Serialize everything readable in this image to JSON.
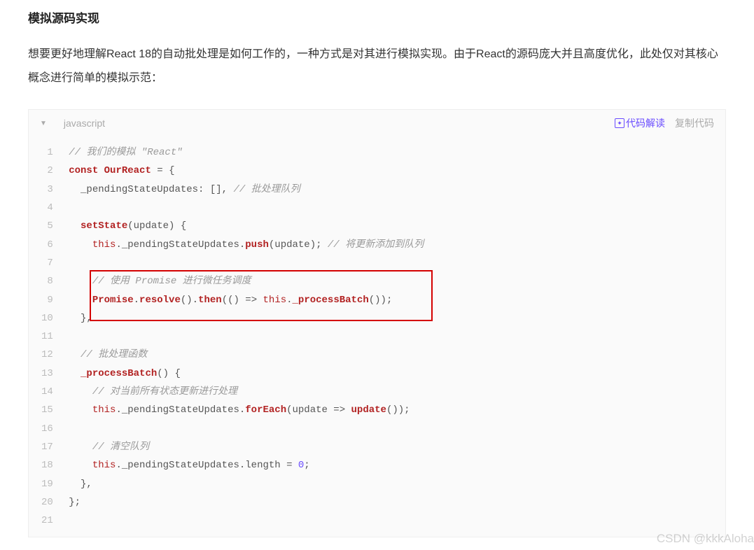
{
  "section_title": "模拟源码实现",
  "paragraph": "想要更好地理解React 18的自动批处理是如何工作的，一种方式是对其进行模拟实现。由于React的源码庞大并且高度优化，此处仅对其核心概念进行简单的模拟示范：",
  "code_header": {
    "language": "javascript",
    "explain_label": "代码解读",
    "copy_label": "复制代码"
  },
  "line_count": 21,
  "code_lines": [
    {
      "tokens": [
        {
          "t": " ",
          "c": ""
        },
        {
          "t": "// 我们的模拟 \"React\"",
          "c": "c-comment"
        }
      ]
    },
    {
      "tokens": [
        {
          "t": " ",
          "c": ""
        },
        {
          "t": "const",
          "c": "c-kw"
        },
        {
          "t": " ",
          "c": ""
        },
        {
          "t": "OurReact",
          "c": "c-fn"
        },
        {
          "t": " = {",
          "c": ""
        }
      ]
    },
    {
      "tokens": [
        {
          "t": "   _pendingStateUpdates: [], ",
          "c": ""
        },
        {
          "t": "// 批处理队列",
          "c": "c-comment"
        }
      ]
    },
    {
      "tokens": []
    },
    {
      "tokens": [
        {
          "t": "   ",
          "c": ""
        },
        {
          "t": "setState",
          "c": "c-fn"
        },
        {
          "t": "(update) {",
          "c": ""
        }
      ]
    },
    {
      "tokens": [
        {
          "t": "     ",
          "c": ""
        },
        {
          "t": "this",
          "c": "c-this"
        },
        {
          "t": "._pendingStateUpdates.",
          "c": ""
        },
        {
          "t": "push",
          "c": "c-fn"
        },
        {
          "t": "(update); ",
          "c": ""
        },
        {
          "t": "// 将更新添加到队列",
          "c": "c-comment"
        }
      ]
    },
    {
      "tokens": []
    },
    {
      "tokens": [
        {
          "t": "     ",
          "c": ""
        },
        {
          "t": "// 使用 Promise 进行微任务调度",
          "c": "c-comment"
        }
      ]
    },
    {
      "tokens": [
        {
          "t": "     ",
          "c": ""
        },
        {
          "t": "Promise",
          "c": "c-fn"
        },
        {
          "t": ".",
          "c": ""
        },
        {
          "t": "resolve",
          "c": "c-fn"
        },
        {
          "t": "().",
          "c": ""
        },
        {
          "t": "then",
          "c": "c-fn"
        },
        {
          "t": "(() => ",
          "c": ""
        },
        {
          "t": "this",
          "c": "c-this"
        },
        {
          "t": ".",
          "c": ""
        },
        {
          "t": "_processBatch",
          "c": "c-fn"
        },
        {
          "t": "());",
          "c": ""
        }
      ]
    },
    {
      "tokens": [
        {
          "t": "   },",
          "c": ""
        }
      ]
    },
    {
      "tokens": []
    },
    {
      "tokens": [
        {
          "t": "   ",
          "c": ""
        },
        {
          "t": "// 批处理函数",
          "c": "c-comment"
        }
      ]
    },
    {
      "tokens": [
        {
          "t": "   ",
          "c": ""
        },
        {
          "t": "_processBatch",
          "c": "c-fn"
        },
        {
          "t": "() {",
          "c": ""
        }
      ]
    },
    {
      "tokens": [
        {
          "t": "     ",
          "c": ""
        },
        {
          "t": "// 对当前所有状态更新进行处理",
          "c": "c-comment"
        }
      ]
    },
    {
      "tokens": [
        {
          "t": "     ",
          "c": ""
        },
        {
          "t": "this",
          "c": "c-this"
        },
        {
          "t": "._pendingStateUpdates.",
          "c": ""
        },
        {
          "t": "forEach",
          "c": "c-fn"
        },
        {
          "t": "(update => ",
          "c": ""
        },
        {
          "t": "update",
          "c": "c-fn"
        },
        {
          "t": "());",
          "c": ""
        }
      ]
    },
    {
      "tokens": []
    },
    {
      "tokens": [
        {
          "t": "     ",
          "c": ""
        },
        {
          "t": "// 清空队列",
          "c": "c-comment"
        }
      ]
    },
    {
      "tokens": [
        {
          "t": "     ",
          "c": ""
        },
        {
          "t": "this",
          "c": "c-this"
        },
        {
          "t": "._pendingStateUpdates.length = ",
          "c": ""
        },
        {
          "t": "0",
          "c": "c-num"
        },
        {
          "t": ";",
          "c": ""
        }
      ]
    },
    {
      "tokens": [
        {
          "t": "   },",
          "c": ""
        }
      ]
    },
    {
      "tokens": [
        {
          "t": " };",
          "c": ""
        }
      ]
    },
    {
      "tokens": []
    }
  ],
  "watermark": "CSDN @kkkAloha"
}
